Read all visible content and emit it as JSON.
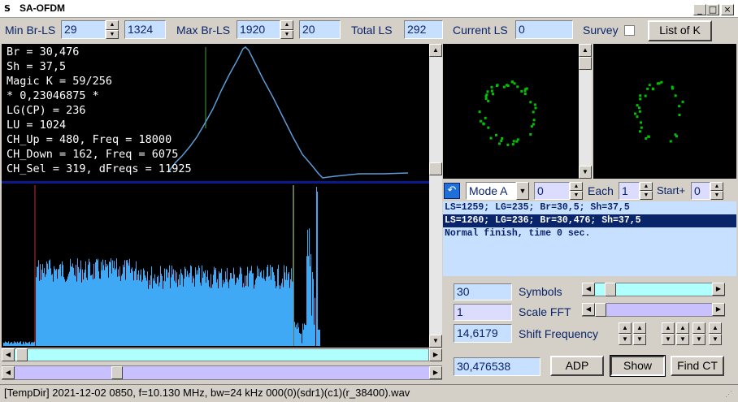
{
  "window": {
    "title": "SA-OFDM",
    "icon_text": "S",
    "minimize": "_",
    "maximize": "□",
    "close": "×"
  },
  "toolbar": {
    "min_br_ls_label": "Min Br-LS",
    "min_br_ls_value": "29",
    "min_br_ls_extra": "1324",
    "max_br_ls_label": "Max Br-LS",
    "max_br_ls_value": "1920",
    "max_br_ls_extra": "20",
    "total_ls_label": "Total LS",
    "total_ls_value": "292",
    "current_ls_label": "Current LS",
    "current_ls_value": "0",
    "survey_label": "Survey",
    "list_of_k_label": "List of K"
  },
  "info": [
    "Br = 30,476",
    "Sh = 37,5",
    "Magic K = 59/256",
    "* 0,23046875 *",
    "LG(CP) = 236",
    "LU = 1024",
    "CH_Up = 480, Freq = 18000",
    "CH_Down = 162, Freq = 6075",
    "CH_Sel = 319, dFreqs = 11925"
  ],
  "controls": {
    "mode_value": "Mode A",
    "mode_num": "0",
    "each_label": "Each",
    "each_value": "1",
    "start_label": "Start+",
    "start_value": "0"
  },
  "log": [
    {
      "text": "LS=1259; LG=235; Br=30,5; Sh=37,5",
      "selected": false
    },
    {
      "text": "LS=1260; LG=236; Br=30,476; Sh=37,5",
      "selected": true
    },
    {
      "text": "Normal finish, time 0 sec.",
      "selected": false
    }
  ],
  "params": {
    "symbols_value": "30",
    "symbols_label": "Symbols",
    "scale_fft_value": "1",
    "scale_fft_label": "Scale FFT",
    "shift_value": "14,6179",
    "shift_label": "Shift Frequency",
    "br_value": "30,476538",
    "adp_label": "ADP",
    "show_label": "Show",
    "find_ct_label": "Find CT"
  },
  "status": {
    "text": "[TempDir] 2021-12-02 0850, f=10.130 MHz, bw=24 kHz 000(0)(sdr1)(c1)(r_38400).wav"
  },
  "colors": {
    "accent": "#0a246a",
    "spectrum": "#3fa9f5",
    "constellation": "#00c000",
    "edit_bg": "#c8e0ff"
  }
}
